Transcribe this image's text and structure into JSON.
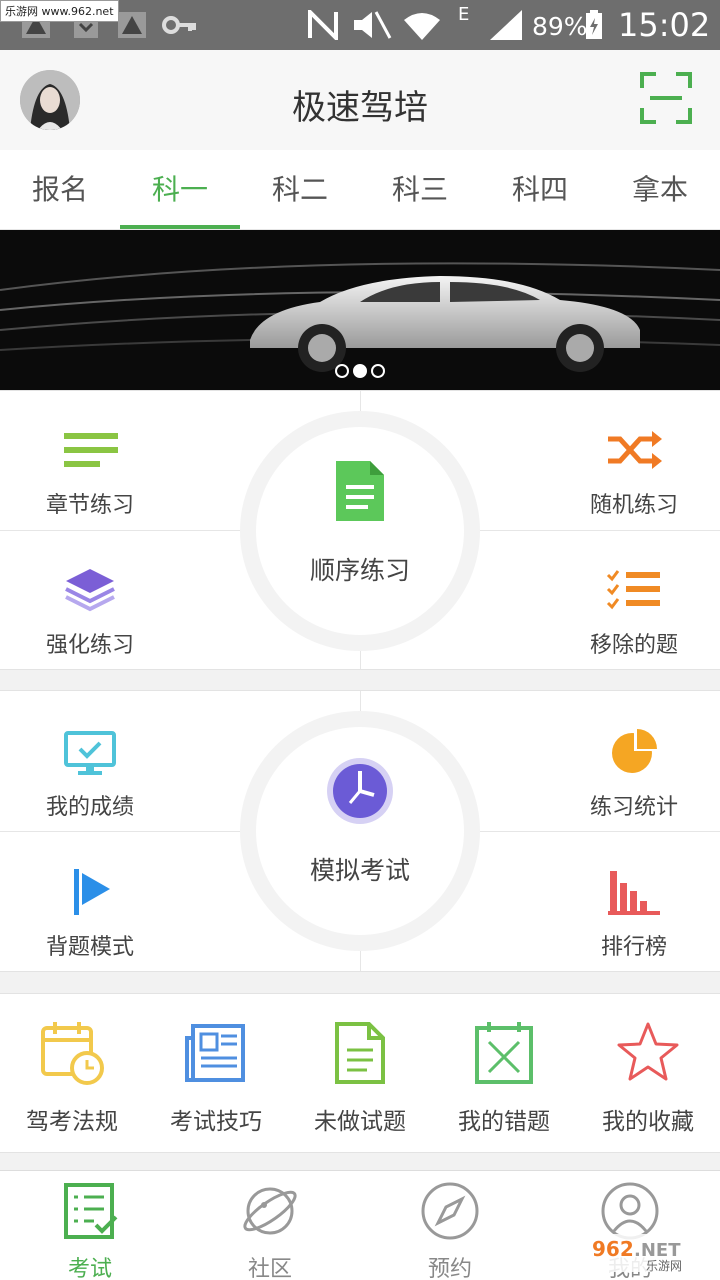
{
  "status_bar": {
    "battery": "89%",
    "time": "15:02",
    "network": "E",
    "watermark": "乐游网 www.962.net"
  },
  "header": {
    "title": "极速驾培"
  },
  "tabs": [
    {
      "label": "报名",
      "active": false
    },
    {
      "label": "科一",
      "active": true
    },
    {
      "label": "科二",
      "active": false
    },
    {
      "label": "科三",
      "active": false
    },
    {
      "label": "科四",
      "active": false
    },
    {
      "label": "拿本",
      "active": false
    }
  ],
  "banner": {
    "slides": 3,
    "active_slide": 2
  },
  "practice": {
    "chapter": "章节练习",
    "random": "随机练习",
    "intensive": "强化练习",
    "removed": "移除的题",
    "sequential": "顺序练习"
  },
  "exam": {
    "scores": "我的成绩",
    "stats": "练习统计",
    "memorize": "背题模式",
    "ranking": "排行榜",
    "mock": "模拟考试"
  },
  "tools": [
    {
      "label": "驾考法规",
      "icon": "calendar-clock-icon"
    },
    {
      "label": "考试技巧",
      "icon": "newspaper-icon"
    },
    {
      "label": "未做试题",
      "icon": "document-icon"
    },
    {
      "label": "我的错题",
      "icon": "wrong-box-icon"
    },
    {
      "label": "我的收藏",
      "icon": "star-icon"
    }
  ],
  "bottom_nav": [
    {
      "label": "考试",
      "active": true
    },
    {
      "label": "社区",
      "active": false
    },
    {
      "label": "预约",
      "active": false
    },
    {
      "label": "我的",
      "active": false
    }
  ],
  "watermark_logo": "962.NET 乐游网",
  "colors": {
    "accent": "#4caf50",
    "orange": "#f08a24",
    "purple": "#6b5bd6",
    "blue": "#2b8fe8",
    "red": "#e84b4b"
  }
}
